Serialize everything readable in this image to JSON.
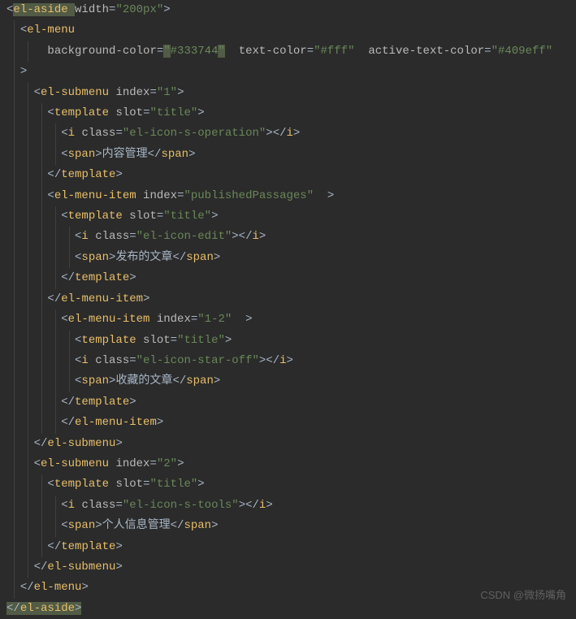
{
  "watermark": "CSDN @微扬嘴角",
  "lines": [
    {
      "indent": 0,
      "guides": [],
      "segs": [
        {
          "t": "<",
          "c": "punct"
        },
        {
          "t": "el-aside ",
          "c": "tag",
          "hl": true
        },
        {
          "t": "width",
          "c": "attr"
        },
        {
          "t": "=",
          "c": "punct"
        },
        {
          "t": "\"200px\"",
          "c": "str"
        },
        {
          "t": ">",
          "c": "punct"
        }
      ]
    },
    {
      "indent": 2,
      "guides": [
        1
      ],
      "segs": [
        {
          "t": "<",
          "c": "punct"
        },
        {
          "t": "el-menu",
          "c": "tag"
        }
      ]
    },
    {
      "indent": 6,
      "guides": [
        1,
        3
      ],
      "segs": [
        {
          "t": "background-color",
          "c": "attr"
        },
        {
          "t": "=",
          "c": "punct"
        },
        {
          "t": "\"",
          "c": "str",
          "hl": true
        },
        {
          "t": "#333744",
          "c": "str"
        },
        {
          "t": "\"",
          "c": "str",
          "hl": true
        },
        {
          "t": "  ",
          "c": "text"
        },
        {
          "t": "text-color",
          "c": "attr"
        },
        {
          "t": "=",
          "c": "punct"
        },
        {
          "t": "\"#fff\"",
          "c": "str"
        },
        {
          "t": "  ",
          "c": "text"
        },
        {
          "t": "active-text-color",
          "c": "attr"
        },
        {
          "t": "=",
          "c": "punct"
        },
        {
          "t": "\"#409eff\"",
          "c": "str"
        }
      ]
    },
    {
      "indent": 2,
      "guides": [
        1
      ],
      "segs": [
        {
          "t": ">",
          "c": "punct"
        }
      ]
    },
    {
      "indent": 4,
      "guides": [
        1,
        3
      ],
      "segs": [
        {
          "t": "<",
          "c": "punct"
        },
        {
          "t": "el-submenu ",
          "c": "tag"
        },
        {
          "t": "index",
          "c": "attr"
        },
        {
          "t": "=",
          "c": "punct"
        },
        {
          "t": "\"1\"",
          "c": "str"
        },
        {
          "t": ">",
          "c": "punct"
        }
      ]
    },
    {
      "indent": 6,
      "guides": [
        1,
        3,
        5
      ],
      "segs": [
        {
          "t": "<",
          "c": "punct"
        },
        {
          "t": "template ",
          "c": "tag"
        },
        {
          "t": "slot",
          "c": "attr"
        },
        {
          "t": "=",
          "c": "punct"
        },
        {
          "t": "\"title\"",
          "c": "str"
        },
        {
          "t": ">",
          "c": "punct"
        }
      ]
    },
    {
      "indent": 8,
      "guides": [
        1,
        3,
        5,
        7
      ],
      "segs": [
        {
          "t": "<",
          "c": "punct"
        },
        {
          "t": "i ",
          "c": "tag"
        },
        {
          "t": "class",
          "c": "attr"
        },
        {
          "t": "=",
          "c": "punct"
        },
        {
          "t": "\"el-icon-s-operation\"",
          "c": "str"
        },
        {
          "t": "></",
          "c": "punct"
        },
        {
          "t": "i",
          "c": "tag"
        },
        {
          "t": ">",
          "c": "punct"
        }
      ]
    },
    {
      "indent": 8,
      "guides": [
        1,
        3,
        5,
        7
      ],
      "segs": [
        {
          "t": "<",
          "c": "punct"
        },
        {
          "t": "span",
          "c": "tag"
        },
        {
          "t": ">",
          "c": "punct"
        },
        {
          "t": "内容管理",
          "c": "text"
        },
        {
          "t": "</",
          "c": "punct"
        },
        {
          "t": "span",
          "c": "tag"
        },
        {
          "t": ">",
          "c": "punct"
        }
      ]
    },
    {
      "indent": 6,
      "guides": [
        1,
        3,
        5
      ],
      "segs": [
        {
          "t": "</",
          "c": "punct"
        },
        {
          "t": "template",
          "c": "tag"
        },
        {
          "t": ">",
          "c": "punct"
        }
      ]
    },
    {
      "indent": 6,
      "guides": [
        1,
        3,
        5
      ],
      "segs": [
        {
          "t": "<",
          "c": "punct"
        },
        {
          "t": "el-menu-item ",
          "c": "tag"
        },
        {
          "t": "index",
          "c": "attr"
        },
        {
          "t": "=",
          "c": "punct"
        },
        {
          "t": "\"publishedPassages\"",
          "c": "str"
        },
        {
          "t": "  >",
          "c": "punct"
        }
      ]
    },
    {
      "indent": 8,
      "guides": [
        1,
        3,
        5,
        7
      ],
      "segs": [
        {
          "t": "<",
          "c": "punct"
        },
        {
          "t": "template ",
          "c": "tag"
        },
        {
          "t": "slot",
          "c": "attr"
        },
        {
          "t": "=",
          "c": "punct"
        },
        {
          "t": "\"title\"",
          "c": "str"
        },
        {
          "t": ">",
          "c": "punct"
        }
      ]
    },
    {
      "indent": 10,
      "guides": [
        1,
        3,
        5,
        7,
        9
      ],
      "segs": [
        {
          "t": "<",
          "c": "punct"
        },
        {
          "t": "i ",
          "c": "tag"
        },
        {
          "t": "class",
          "c": "attr"
        },
        {
          "t": "=",
          "c": "punct"
        },
        {
          "t": "\"el-icon-edit\"",
          "c": "str"
        },
        {
          "t": "></",
          "c": "punct"
        },
        {
          "t": "i",
          "c": "tag"
        },
        {
          "t": ">",
          "c": "punct"
        }
      ]
    },
    {
      "indent": 10,
      "guides": [
        1,
        3,
        5,
        7,
        9
      ],
      "segs": [
        {
          "t": "<",
          "c": "punct"
        },
        {
          "t": "span",
          "c": "tag"
        },
        {
          "t": ">",
          "c": "punct"
        },
        {
          "t": "发布的文章",
          "c": "text"
        },
        {
          "t": "</",
          "c": "punct"
        },
        {
          "t": "span",
          "c": "tag"
        },
        {
          "t": ">",
          "c": "punct"
        }
      ]
    },
    {
      "indent": 8,
      "guides": [
        1,
        3,
        5,
        7
      ],
      "segs": [
        {
          "t": "</",
          "c": "punct"
        },
        {
          "t": "template",
          "c": "tag"
        },
        {
          "t": ">",
          "c": "punct"
        }
      ]
    },
    {
      "indent": 6,
      "guides": [
        1,
        3,
        5
      ],
      "segs": [
        {
          "t": "</",
          "c": "punct"
        },
        {
          "t": "el-menu-item",
          "c": "tag"
        },
        {
          "t": ">",
          "c": "punct"
        }
      ]
    },
    {
      "indent": 8,
      "guides": [
        1,
        3,
        5,
        7
      ],
      "segs": [
        {
          "t": "<",
          "c": "punct"
        },
        {
          "t": "el-menu-item ",
          "c": "tag"
        },
        {
          "t": "index",
          "c": "attr"
        },
        {
          "t": "=",
          "c": "punct"
        },
        {
          "t": "\"1-2\"",
          "c": "str"
        },
        {
          "t": "  >",
          "c": "punct"
        }
      ]
    },
    {
      "indent": 10,
      "guides": [
        1,
        3,
        5,
        7,
        9
      ],
      "segs": [
        {
          "t": "<",
          "c": "punct"
        },
        {
          "t": "template ",
          "c": "tag"
        },
        {
          "t": "slot",
          "c": "attr"
        },
        {
          "t": "=",
          "c": "punct"
        },
        {
          "t": "\"title\"",
          "c": "str"
        },
        {
          "t": ">",
          "c": "punct"
        }
      ]
    },
    {
      "indent": 10,
      "guides": [
        1,
        3,
        5,
        7,
        9
      ],
      "segs": [
        {
          "t": "<",
          "c": "punct"
        },
        {
          "t": "i ",
          "c": "tag"
        },
        {
          "t": "class",
          "c": "attr"
        },
        {
          "t": "=",
          "c": "punct"
        },
        {
          "t": "\"el-icon-star-off\"",
          "c": "str"
        },
        {
          "t": "></",
          "c": "punct"
        },
        {
          "t": "i",
          "c": "tag"
        },
        {
          "t": ">",
          "c": "punct"
        }
      ]
    },
    {
      "indent": 10,
      "guides": [
        1,
        3,
        5,
        7,
        9
      ],
      "segs": [
        {
          "t": "<",
          "c": "punct"
        },
        {
          "t": "span",
          "c": "tag"
        },
        {
          "t": ">",
          "c": "punct"
        },
        {
          "t": "收藏的文章",
          "c": "text"
        },
        {
          "t": "</",
          "c": "punct"
        },
        {
          "t": "span",
          "c": "tag"
        },
        {
          "t": ">",
          "c": "punct"
        }
      ]
    },
    {
      "indent": 8,
      "guides": [
        1,
        3,
        5,
        7
      ],
      "segs": [
        {
          "t": "</",
          "c": "punct"
        },
        {
          "t": "template",
          "c": "tag"
        },
        {
          "t": ">",
          "c": "punct"
        }
      ]
    },
    {
      "indent": 8,
      "guides": [
        1,
        3,
        5,
        7
      ],
      "segs": [
        {
          "t": "</",
          "c": "punct"
        },
        {
          "t": "el-menu-item",
          "c": "tag"
        },
        {
          "t": ">",
          "c": "punct"
        }
      ]
    },
    {
      "indent": 4,
      "guides": [
        1,
        3
      ],
      "segs": [
        {
          "t": "</",
          "c": "punct"
        },
        {
          "t": "el-submenu",
          "c": "tag"
        },
        {
          "t": ">",
          "c": "punct"
        }
      ]
    },
    {
      "indent": 4,
      "guides": [
        1,
        3
      ],
      "segs": [
        {
          "t": "<",
          "c": "punct"
        },
        {
          "t": "el-submenu ",
          "c": "tag"
        },
        {
          "t": "index",
          "c": "attr"
        },
        {
          "t": "=",
          "c": "punct"
        },
        {
          "t": "\"2\"",
          "c": "str"
        },
        {
          "t": ">",
          "c": "punct"
        }
      ]
    },
    {
      "indent": 6,
      "guides": [
        1,
        3,
        5
      ],
      "segs": [
        {
          "t": "<",
          "c": "punct"
        },
        {
          "t": "template ",
          "c": "tag"
        },
        {
          "t": "slot",
          "c": "attr"
        },
        {
          "t": "=",
          "c": "punct"
        },
        {
          "t": "\"title\"",
          "c": "str"
        },
        {
          "t": ">",
          "c": "punct"
        }
      ]
    },
    {
      "indent": 8,
      "guides": [
        1,
        3,
        5,
        7
      ],
      "segs": [
        {
          "t": "<",
          "c": "punct"
        },
        {
          "t": "i ",
          "c": "tag"
        },
        {
          "t": "class",
          "c": "attr"
        },
        {
          "t": "=",
          "c": "punct"
        },
        {
          "t": "\"el-icon-s-tools\"",
          "c": "str"
        },
        {
          "t": "></",
          "c": "punct"
        },
        {
          "t": "i",
          "c": "tag"
        },
        {
          "t": ">",
          "c": "punct"
        }
      ]
    },
    {
      "indent": 8,
      "guides": [
        1,
        3,
        5,
        7
      ],
      "segs": [
        {
          "t": "<",
          "c": "punct"
        },
        {
          "t": "span",
          "c": "tag"
        },
        {
          "t": ">",
          "c": "punct"
        },
        {
          "t": "个人信息管理",
          "c": "text"
        },
        {
          "t": "</",
          "c": "punct"
        },
        {
          "t": "span",
          "c": "tag"
        },
        {
          "t": ">",
          "c": "punct"
        }
      ]
    },
    {
      "indent": 6,
      "guides": [
        1,
        3,
        5
      ],
      "segs": [
        {
          "t": "</",
          "c": "punct"
        },
        {
          "t": "template",
          "c": "tag"
        },
        {
          "t": ">",
          "c": "punct"
        }
      ]
    },
    {
      "indent": 4,
      "guides": [
        1,
        3
      ],
      "segs": [
        {
          "t": "</",
          "c": "punct"
        },
        {
          "t": "el-submenu",
          "c": "tag"
        },
        {
          "t": ">",
          "c": "punct"
        }
      ]
    },
    {
      "indent": 2,
      "guides": [
        1
      ],
      "segs": [
        {
          "t": "</",
          "c": "punct"
        },
        {
          "t": "el-menu",
          "c": "tag"
        },
        {
          "t": ">",
          "c": "punct"
        }
      ]
    },
    {
      "indent": 0,
      "guides": [],
      "segs": [
        {
          "t": "</",
          "c": "punct",
          "hl": true
        },
        {
          "t": "el-aside",
          "c": "tag",
          "hl": true
        },
        {
          "t": ">",
          "c": "punct",
          "hl": true
        }
      ]
    }
  ]
}
